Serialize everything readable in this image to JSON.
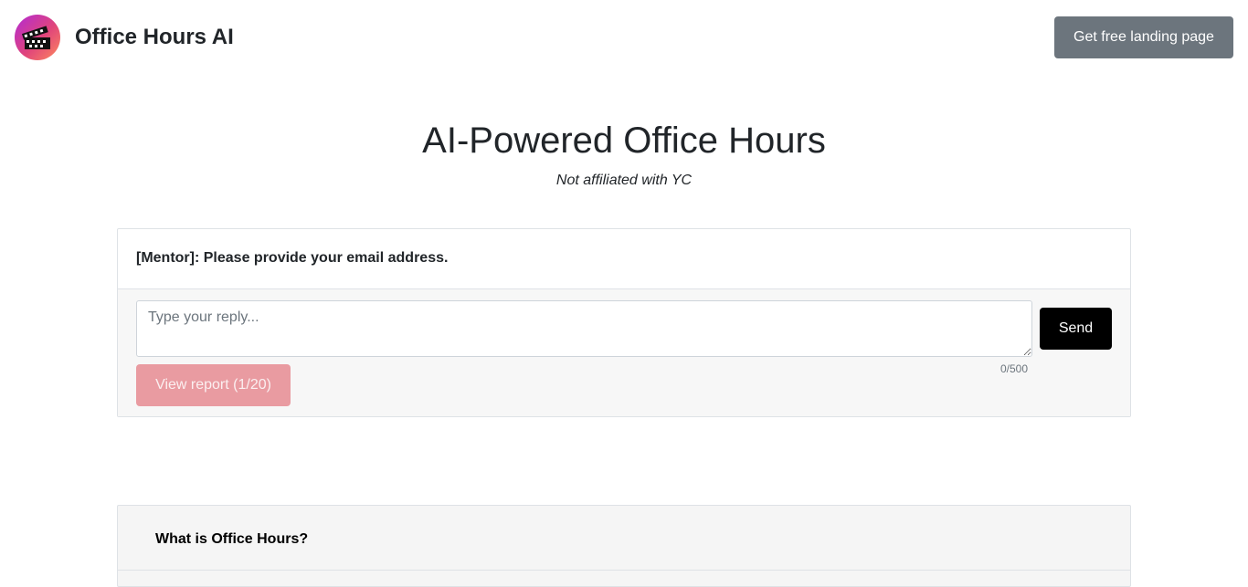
{
  "header": {
    "brand_name": "Office Hours AI",
    "cta_label": "Get free landing page"
  },
  "hero": {
    "title": "AI-Powered Office Hours",
    "subtitle": "Not affiliated with YC"
  },
  "chat": {
    "message": "[Mentor]: Please provide your email address.",
    "input_placeholder": "Type your reply...",
    "input_value": "",
    "char_count": "0/500",
    "send_label": "Send",
    "report_label": "View report (1/20)"
  },
  "faq": {
    "question": "What is Office Hours?"
  },
  "colors": {
    "cta_background": "#6c757d",
    "send_background": "#000000",
    "report_background": "#e99ba1",
    "footer_background": "#f7f7f7"
  },
  "icons": {
    "logo": "office-hours-logo-icon"
  }
}
